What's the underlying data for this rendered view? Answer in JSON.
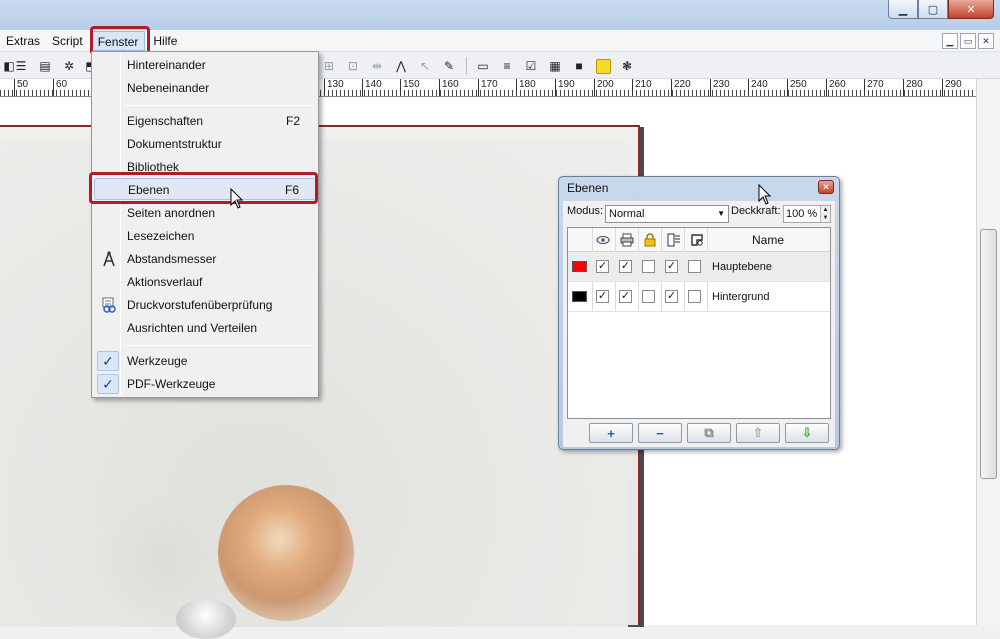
{
  "colors": {
    "highlight": "#b01d2a",
    "titlebar": "#c9daf0",
    "layer_red": "#ff0000",
    "layer_black": "#000000",
    "check": "#1d3c8c"
  },
  "window": {
    "min_icon": "minimize-icon",
    "max_icon": "maximize-icon",
    "close_icon": "close-icon",
    "min_glyph": "▁",
    "max_glyph": "▢",
    "close_glyph": "✕"
  },
  "menubar": {
    "items": [
      "Extras",
      "Script",
      "Fenster",
      "Hilfe"
    ],
    "mdi": [
      "▁",
      "▭",
      "✕"
    ]
  },
  "toolbar": {
    "icons": [
      "◧",
      "☰",
      "▤",
      "✲",
      "⬒",
      "⊞",
      "⊡",
      "⇹",
      "⋀",
      "↖",
      "✎",
      "▭",
      "≡",
      "☑",
      "▦",
      "■",
      "❃"
    ]
  },
  "ruler": {
    "labels": [
      "50",
      "60",
      "130",
      "140",
      "150",
      "160",
      "170",
      "180",
      "190",
      "200",
      "210",
      "220",
      "230",
      "240",
      "250",
      "260",
      "270",
      "280",
      "290"
    ]
  },
  "fenster_menu": {
    "items": [
      {
        "label": "Hintereinander",
        "shortcut": ""
      },
      {
        "label": "Nebeneinander",
        "shortcut": ""
      },
      {
        "label": "Eigenschaften",
        "shortcut": "F2"
      },
      {
        "label": "Dokumentstruktur",
        "shortcut": ""
      },
      {
        "label": "Bibliothek",
        "shortcut": ""
      },
      {
        "label": "Ebenen",
        "shortcut": "F6"
      },
      {
        "label": "Seiten anordnen",
        "shortcut": ""
      },
      {
        "label": "Lesezeichen",
        "shortcut": ""
      },
      {
        "label": "Abstandsmesser",
        "shortcut": "",
        "icon": "measure-icon"
      },
      {
        "label": "Aktionsverlauf",
        "shortcut": ""
      },
      {
        "label": "Druckvorstufenüberprüfung",
        "shortcut": "",
        "icon": "preflight-icon"
      },
      {
        "label": "Ausrichten und Verteilen",
        "shortcut": ""
      },
      {
        "label": "Werkzeuge",
        "shortcut": "",
        "checked": true
      },
      {
        "label": "PDF-Werkzeuge",
        "shortcut": "",
        "checked": true
      }
    ],
    "check_glyph": "✓"
  },
  "layers_panel": {
    "title": "Ebenen",
    "modus_label": "Modus:",
    "modus_value": "Normal",
    "deckkraft_label": "Deckkraft:",
    "deckkraft_value": "100 %",
    "name_header": "Name",
    "header_icons": [
      "eye-icon",
      "printer-icon",
      "lock-icon",
      "flow-icon",
      "outline-icon"
    ],
    "header_glyphs": [
      "👁",
      "🖶",
      "🔒",
      "⇶",
      "⌘"
    ],
    "layers": [
      {
        "name": "Hauptebene",
        "color": "#ff0000",
        "visible": true,
        "print": true,
        "locked": false,
        "flow": true,
        "outline": false
      },
      {
        "name": "Hintergrund",
        "color": "#000000",
        "visible": true,
        "print": true,
        "locked": false,
        "flow": true,
        "outline": false
      }
    ],
    "buttons": [
      {
        "name": "add-layer-button",
        "glyph": "+",
        "color": "#1f5fb5"
      },
      {
        "name": "remove-layer-button",
        "glyph": "−",
        "color": "#1f5fb5"
      },
      {
        "name": "duplicate-layer-button",
        "glyph": "⧉",
        "color": "#8a8a8a"
      },
      {
        "name": "raise-layer-button",
        "glyph": "⇧",
        "color": "#9a9a9a"
      },
      {
        "name": "lower-layer-button",
        "glyph": "⇩",
        "color": "#2f9a1f"
      }
    ],
    "check_glyph": "✓"
  }
}
